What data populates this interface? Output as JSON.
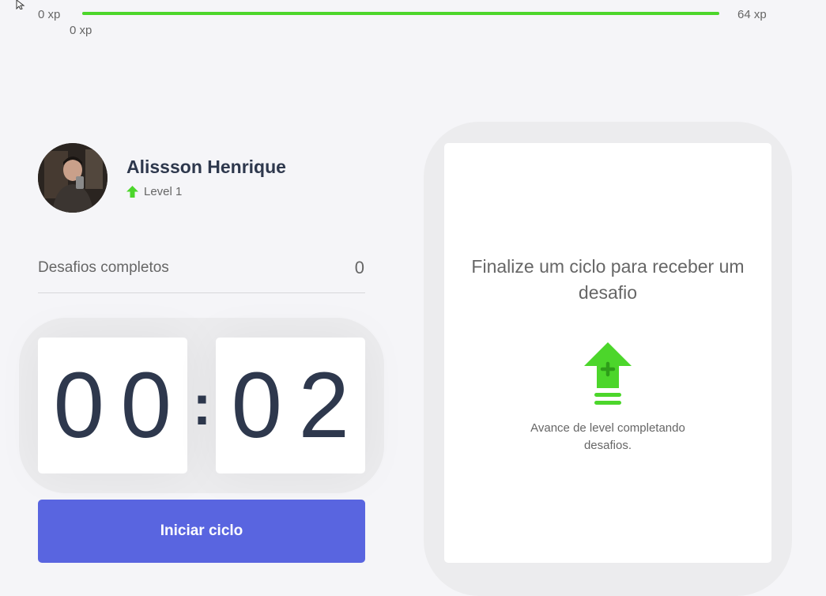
{
  "xp_bar": {
    "min_label": "0 xp",
    "max_label": "64 xp",
    "current_label": "0 xp",
    "progress": 1.0,
    "fill_color": "#4CD62B"
  },
  "profile": {
    "name": "Alissson Henrique",
    "level_label": "Level 1",
    "level_icon": "level-up-arrow-icon"
  },
  "completed_challenges": {
    "label": "Desafios completos",
    "count": "0"
  },
  "countdown": {
    "minute_left": "0",
    "minute_right": "0",
    "separator": ":",
    "second_left": "0",
    "second_right": "2"
  },
  "start_button": {
    "label": "Iniciar ciclo",
    "color": "#5965E0"
  },
  "challenge_card": {
    "title": "Finalize um ciclo para receber um desafio",
    "icon": "level-up-icon",
    "caption": "Avance de level completando desafios."
  },
  "colors": {
    "background": "#F5F5F8",
    "text_primary": "#2E384D",
    "text_secondary": "#666666",
    "accent_green": "#4CD62B"
  }
}
